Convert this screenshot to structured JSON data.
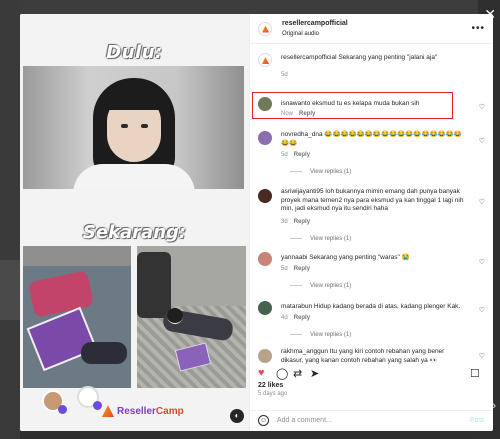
{
  "header": {
    "username": "resellercampofficial",
    "audio": "Original audio",
    "more": "•••"
  },
  "media": {
    "caption_top": "Dulu:",
    "caption_bottom": "Sekarang:",
    "brand_prefix": "Reseller",
    "brand_suffix": "Camp",
    "mute_icon": "◐"
  },
  "caption_post": {
    "text": "resellercampofficial Sekarang yang penting \"jalani aja\"",
    "time": "5d"
  },
  "comments": [
    {
      "text": "isnawanto eksmud tu es kelapa muda bukan sih",
      "time": "Now",
      "reply": "Reply",
      "avatar_color": "#6e7a58"
    },
    {
      "text": "novredha_dna 😂😂😂😂😂😂😂😂😂😂😂😂😂😂😂😂😂😂😂",
      "time": "5d",
      "reply": "Reply",
      "view_replies": "View replies (1)",
      "avatar_color": "#8a6fb0"
    },
    {
      "text": "asriwijayanti95 loh bukannya mimin emang dah punya banyak proyek mana temen2 nya para eksmud ya kan tinggal 1 lagi nih min, jadi eksmud nya itu sendiri haha",
      "time": "3d",
      "reply": "Reply",
      "view_replies": "View replies (1)",
      "avatar_color": "#4a2a22"
    },
    {
      "text": "yannaabi Sekarang yang penting \"waras\" 😭",
      "time": "5d",
      "reply": "Reply",
      "view_replies": "View replies (1)",
      "avatar_color": "#c9847a"
    },
    {
      "text": "matarabun Hidup kadang berada di atas, kadang plenger Kak.",
      "time": "4d",
      "reply": "Reply",
      "view_replies": "View replies (1)",
      "avatar_color": "#44624e"
    },
    {
      "text": "rakhma_anggun Itu yang kiri contoh rebahan yang bener dikasur, yang kanan contoh rebahan yang salah ya 👀",
      "avatar_color": "#b8a48c"
    }
  ],
  "actions": {
    "like_icon": "♥",
    "comment_icon": "◯",
    "share_icon": "➤",
    "save_icon": "☐"
  },
  "likes": "22 likes",
  "ago": "5 days ago",
  "add_comment": {
    "placeholder": "Add a comment...",
    "post": "Post",
    "emoji_icon": "☺"
  },
  "colors": {
    "highlight": "#e0252b",
    "like": "#ed4956",
    "brand_purple": "#7a3fbf",
    "brand_orange": "#e5452b"
  }
}
